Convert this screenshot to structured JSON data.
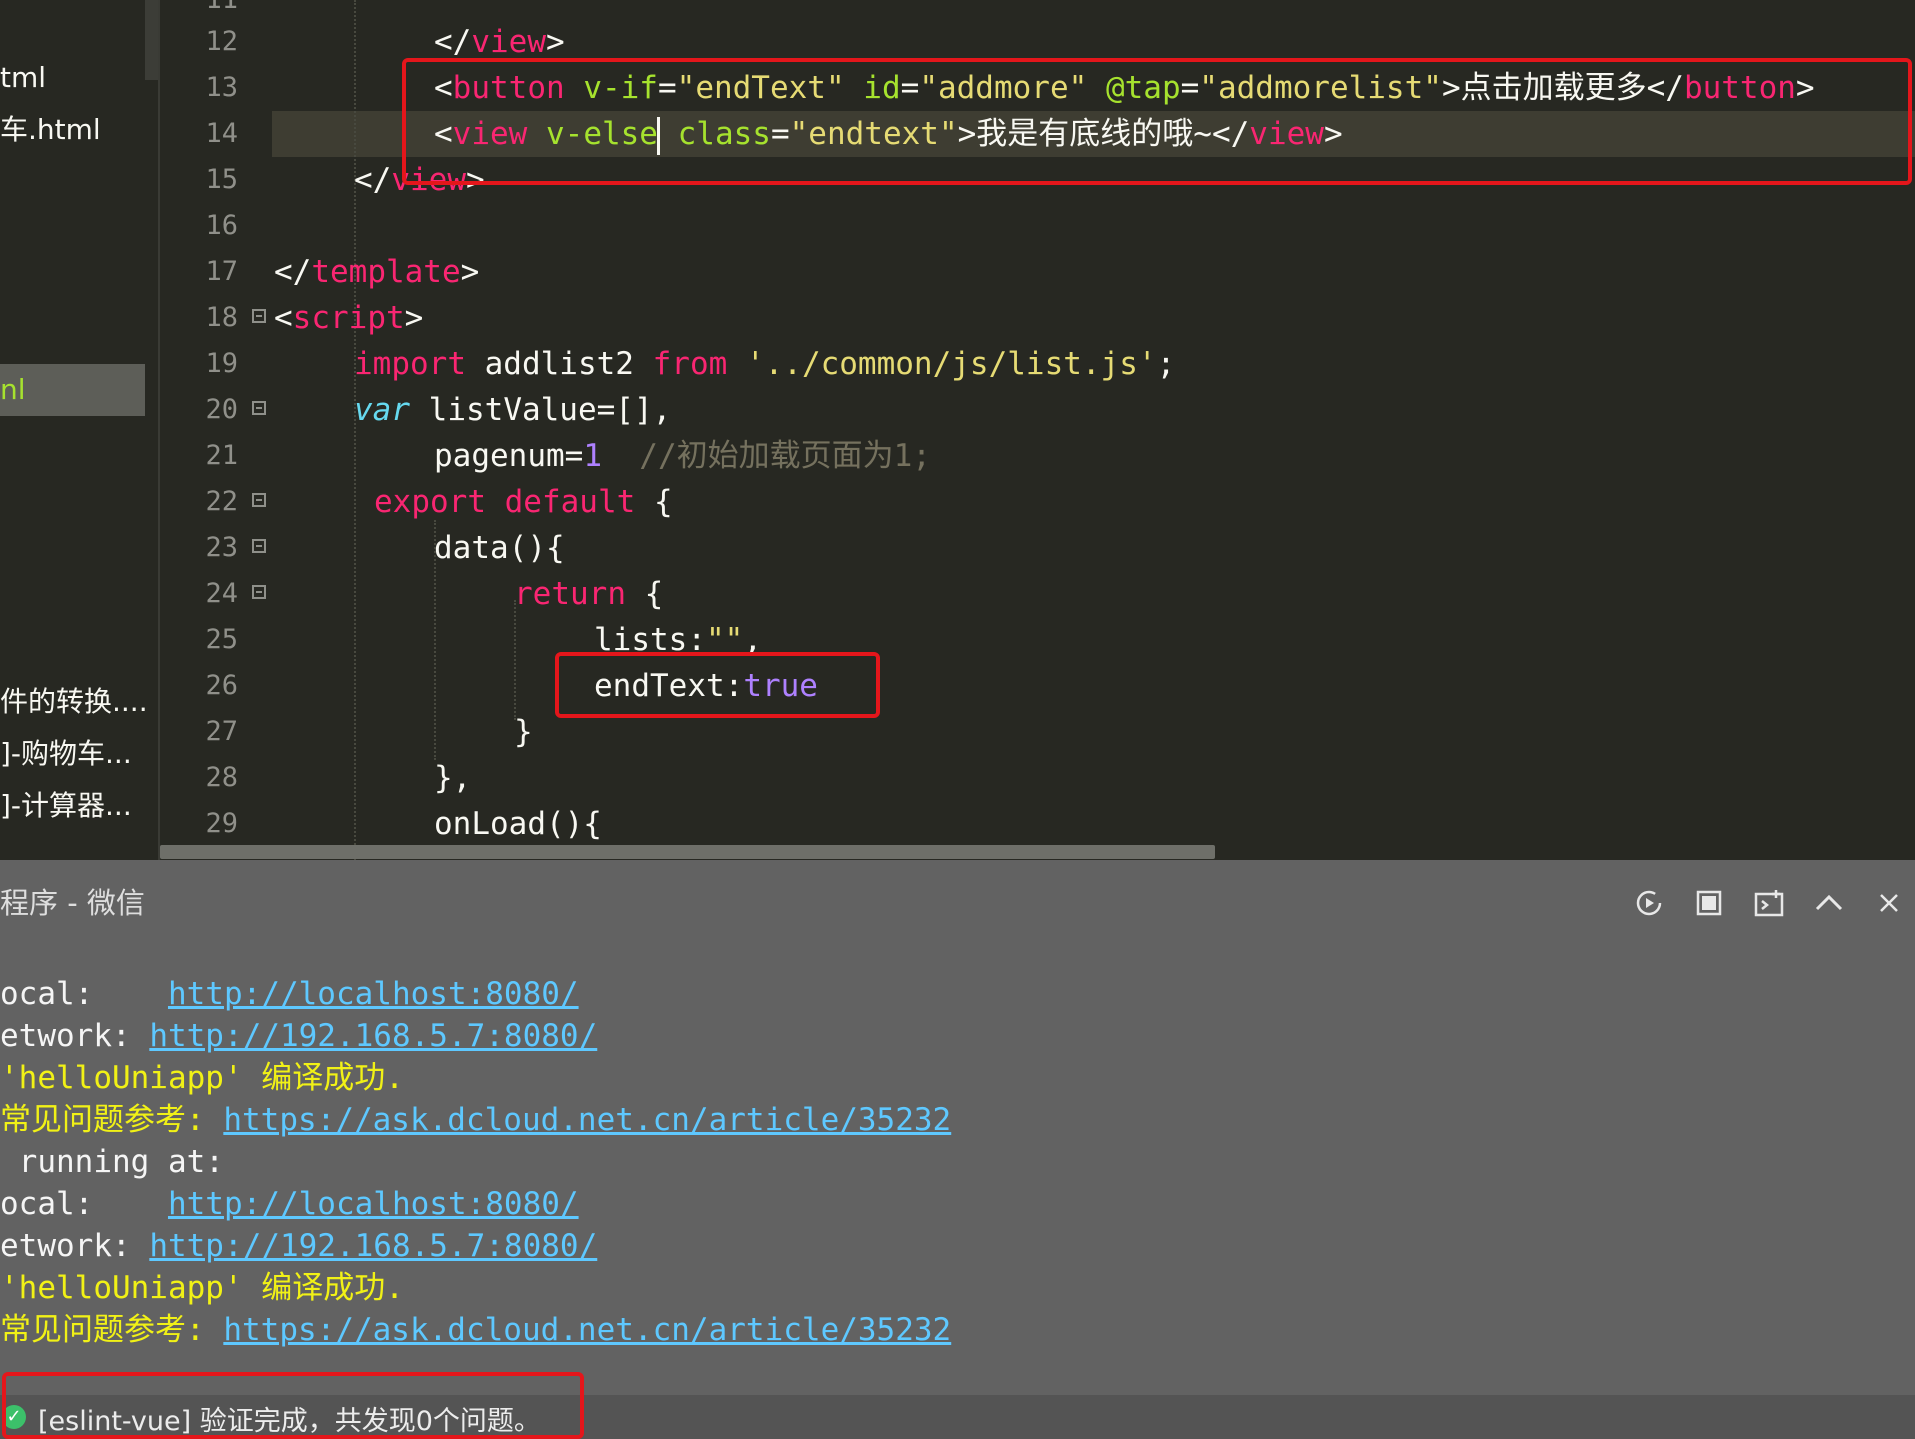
{
  "sidebar": {
    "items": [
      {
        "label": "tml",
        "active": false
      },
      {
        "label": "车.html",
        "active": false
      },
      {
        "label": "nl",
        "active": true
      },
      {
        "label": "件的转换....",
        "active": false
      },
      {
        "label": "]-购物车...",
        "active": false
      },
      {
        "label": "]-计算器...",
        "active": false
      }
    ]
  },
  "editor": {
    "line_numbers": [
      "11",
      "12",
      "13",
      "14",
      "15",
      "16",
      "17",
      "18",
      "19",
      "20",
      "21",
      "22",
      "23",
      "24",
      "25",
      "26",
      "27",
      "28",
      "29"
    ],
    "code": {
      "l12": {
        "lt": "</",
        "tag": "view",
        "gt": ">"
      },
      "l13": {
        "lt": "<",
        "tag": "button",
        "a1": " v-if",
        "eq1": "=",
        "v1": "\"endText\"",
        "a2": " id",
        "eq2": "=",
        "v2": "\"addmore\"",
        "a3": " @tap",
        "eq3": "=",
        "v3": "\"addmorelist\"",
        "txt": ">点击加载更多</",
        "tag2": "button",
        "gt": ">"
      },
      "l14": {
        "lt": "<",
        "tag": "view",
        "a1": " v-else",
        "a2": " class",
        "eq2": "=",
        "v2": "\"endtext\"",
        "txt": ">我是有底线的哦~</",
        "tag2": "view",
        "gt": ">"
      },
      "l15": {
        "lt": "</",
        "tag": "view",
        "gt": ">"
      },
      "l17": {
        "lt": "</",
        "tag": "template",
        "gt": ">"
      },
      "l18": {
        "lt": "<",
        "tag": "script",
        "gt": ">"
      },
      "l19": {
        "kw1": "import",
        "mid": " addlist2 ",
        "kw2": "from",
        "sp": " ",
        "str": "'../common/js/list.js'",
        "end": ";"
      },
      "l20": {
        "kw": "var",
        "rest": " listValue=[],"
      },
      "l21": {
        "pre": "pagenum=",
        "num": "1",
        "cmt": "  //初始加载页面为1;"
      },
      "l22": {
        "kw": "export default",
        "rest": " {"
      },
      "l23": {
        "text": "data(){"
      },
      "l24": {
        "kw": "return",
        "rest": " {"
      },
      "l25": {
        "pre": "lists:",
        "str": "\"\"",
        "end": ","
      },
      "l26": {
        "pre": "endText:",
        "val": "true"
      },
      "l27": {
        "text": "}"
      },
      "l28": {
        "text": "},"
      },
      "l29": {
        "text": "onLoad(){"
      }
    }
  },
  "console": {
    "title": "程序 - 微信",
    "lines": [
      {
        "label": "ocal:    ",
        "link": "http://localhost:8080/"
      },
      {
        "label": "etwork: ",
        "link": "http://192.168.5.7:8080/"
      },
      {
        "y": "'helloUniapp' 编译成功."
      },
      {
        "y": "常见问题参考: ",
        "link": "https://ask.dcloud.net.cn/article/35232"
      },
      {
        "label": " running at:"
      },
      {
        "label": "ocal:    ",
        "link": "http://localhost:8080/"
      },
      {
        "label": "etwork: ",
        "link": "http://192.168.5.7:8080/"
      },
      {
        "y": "'helloUniapp' 编译成功."
      },
      {
        "y": "常见问题参考: ",
        "link": "https://ask.dcloud.net.cn/article/35232"
      }
    ]
  },
  "status": {
    "text": "[eslint-vue] 验证完成，共发现0个问题。"
  },
  "colors": {
    "highlight_box": "#e4161b",
    "editor_bg": "#272822",
    "console_bg": "#626262",
    "link": "#5ec8ff",
    "success": "#f1f116"
  },
  "icons": [
    "run-icon",
    "stop-icon",
    "open-terminal-icon",
    "collapse-icon",
    "close-icon"
  ]
}
